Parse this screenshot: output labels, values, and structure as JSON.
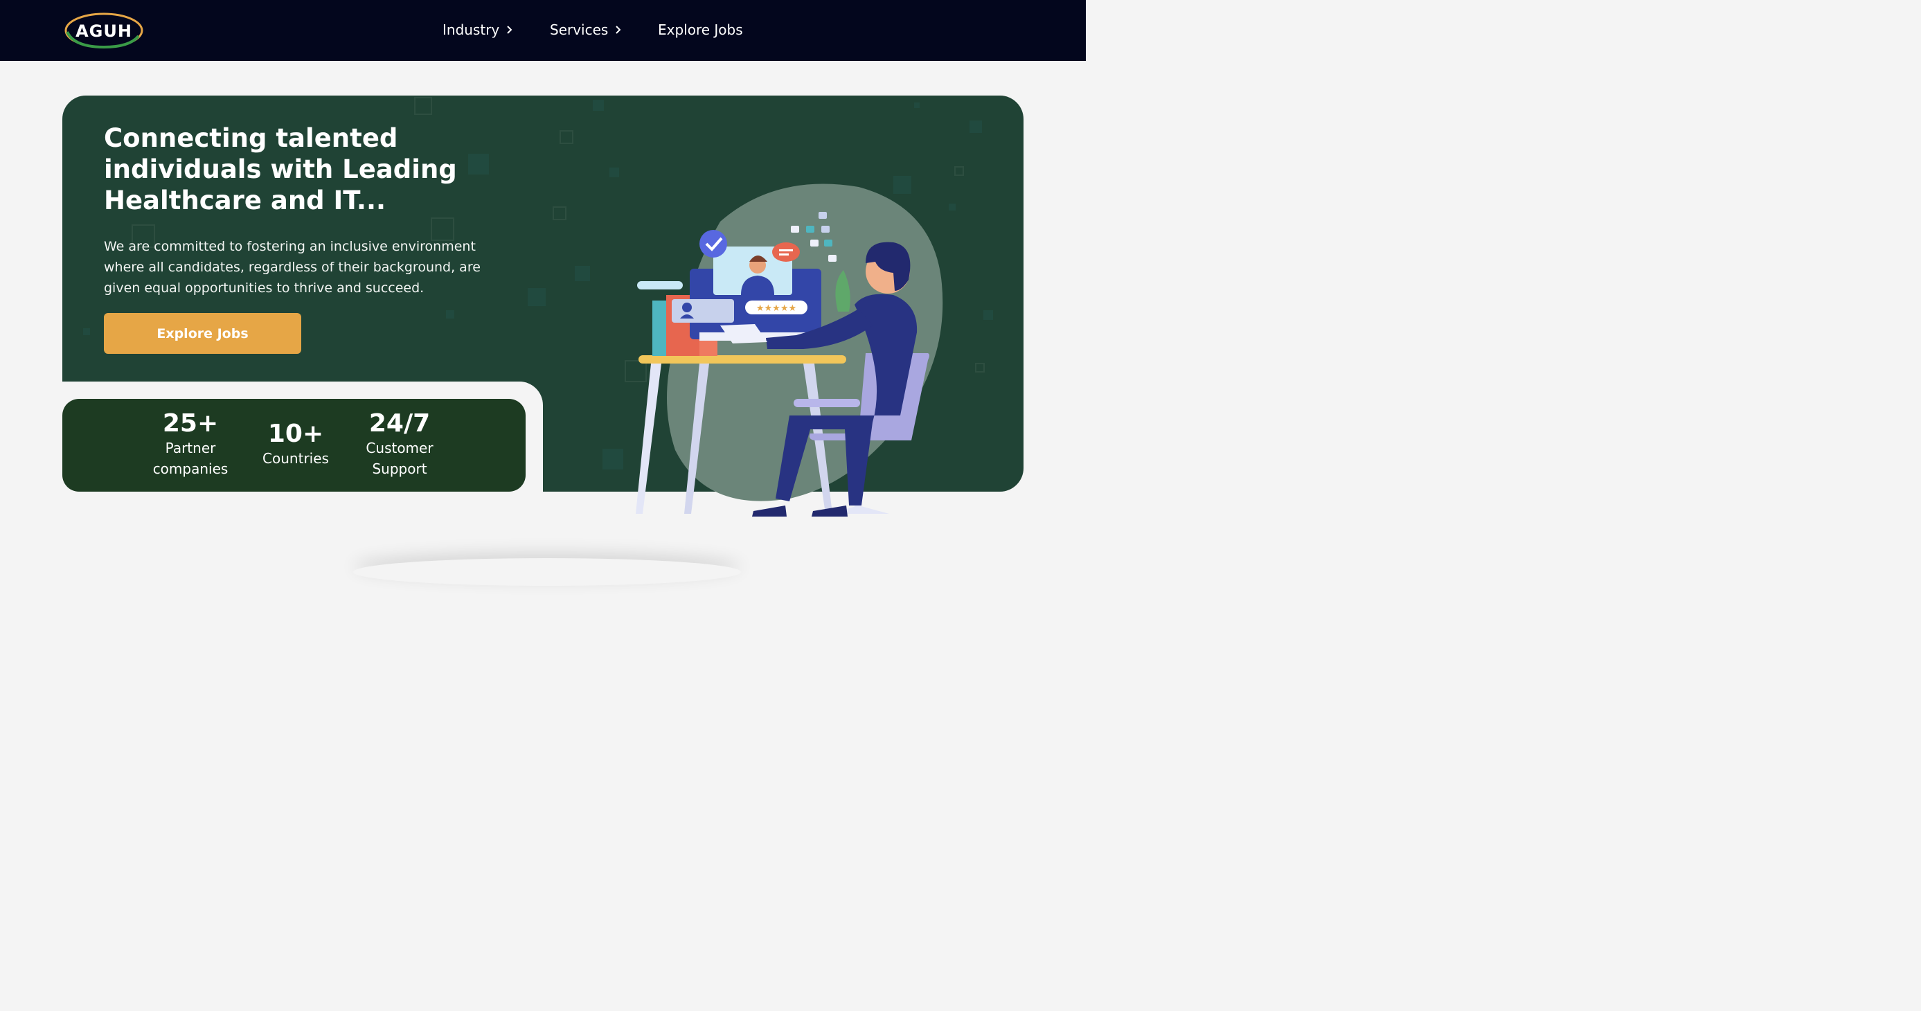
{
  "header": {
    "logo_text": "AGUH",
    "nav": [
      {
        "label": "Industry",
        "has_chevron": true
      },
      {
        "label": "Services",
        "has_chevron": true
      },
      {
        "label": "Explore Jobs",
        "has_chevron": false
      }
    ]
  },
  "hero": {
    "headline": "Connecting talented individuals with Leading Healthcare and IT...",
    "subtext": "We are committed to fostering an inclusive environment where all candidates, regardless of their background, are given equal opportunities to thrive and succeed.",
    "cta_label": "Explore Jobs"
  },
  "stats": [
    {
      "value": "25+",
      "label": "Partner\ncompanies"
    },
    {
      "value": "10+",
      "label": "Countries"
    },
    {
      "value": "24/7",
      "label": "Customer\nSupport"
    }
  ],
  "colors": {
    "topbar": "#03061d",
    "hero": "#204335",
    "stats_card": "#1d3b22",
    "cta": "#e6a646",
    "page": "#f4f4f4"
  },
  "icons": {
    "nav_chevron": "chevron-right-icon",
    "illustration": "recruiter-at-desk-illustration"
  }
}
